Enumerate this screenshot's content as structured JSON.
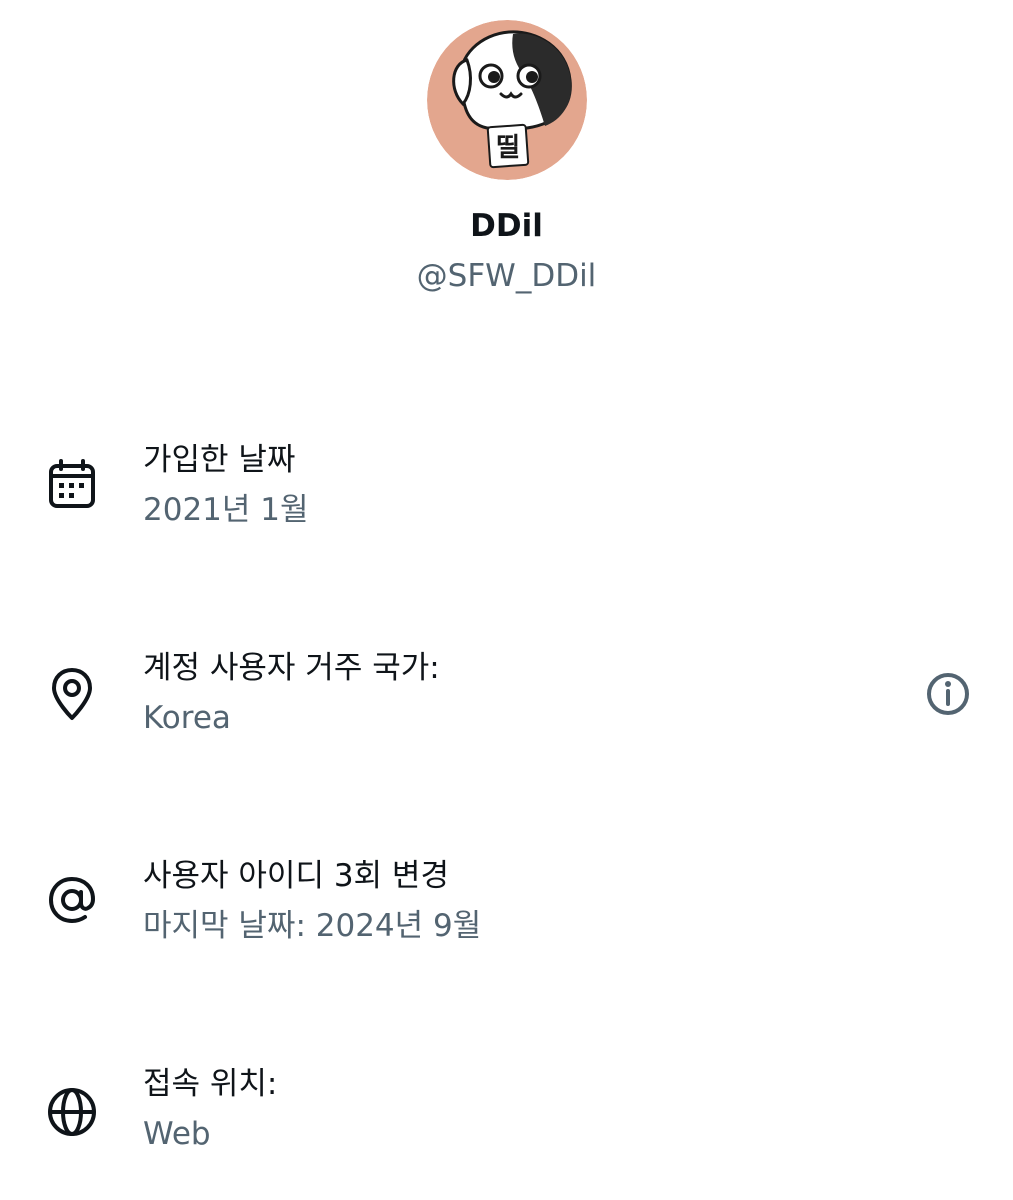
{
  "profile": {
    "display_name": "DDil",
    "handle": "@SFW_DDil",
    "avatar_icon": "dog-cartoon-avatar",
    "avatar_text": "띨",
    "avatar_bg": "#E3A68E"
  },
  "about": {
    "rows": [
      {
        "icon": "calendar-icon",
        "title": "가입한 날짜",
        "value": "2021년 1월"
      },
      {
        "icon": "location-pin-icon",
        "title": "계정 사용자 거주 국가:",
        "value": "Korea",
        "action_icon": "info-icon"
      },
      {
        "icon": "at-sign-icon",
        "title": "사용자 아이디 3회 변경",
        "value": "마지막 날짜: 2024년 9월"
      },
      {
        "icon": "globe-icon",
        "title": "접속 위치:",
        "value": "Web"
      }
    ]
  },
  "colors": {
    "primary_text": "#0F1419",
    "secondary_text": "#536471"
  }
}
